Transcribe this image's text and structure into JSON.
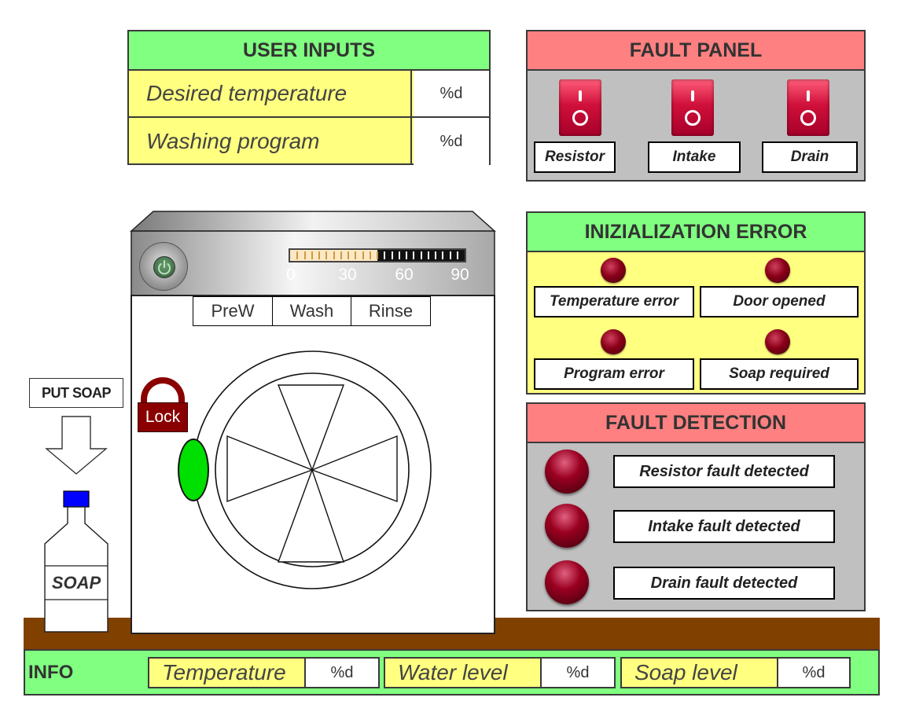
{
  "user_inputs": {
    "title": "USER INPUTS",
    "rows": [
      {
        "label": "Desired temperature",
        "value": "%d"
      },
      {
        "label": "Washing program",
        "value": "%d"
      }
    ]
  },
  "fault_panel": {
    "title": "FAULT PANEL",
    "switches": [
      {
        "label": "Resistor"
      },
      {
        "label": "Intake"
      },
      {
        "label": "Drain"
      }
    ]
  },
  "init_error": {
    "title": "INIZIALIZATION ERROR",
    "indicators": [
      {
        "label": "Temperature error"
      },
      {
        "label": "Door opened"
      },
      {
        "label": "Program error"
      },
      {
        "label": "Soap required"
      }
    ]
  },
  "fault_detection": {
    "title": "FAULT DETECTION",
    "indicators": [
      {
        "label": "Resistor fault detected"
      },
      {
        "label": "Intake fault detected"
      },
      {
        "label": "Drain fault detected"
      }
    ]
  },
  "machine": {
    "gauge_ticks": [
      "0",
      "30",
      "60",
      "90"
    ],
    "gauge_fill_fraction": 0.5,
    "programs": [
      "PreW",
      "Wash",
      "Rinse"
    ],
    "lock_label": "Lock",
    "door_handle_color": "#00e000"
  },
  "soap": {
    "button_label": "PUT SOAP",
    "bottle_label": "SOAP",
    "cap_color": "#0000ff"
  },
  "info": {
    "title": "INFO",
    "fields": [
      {
        "label": "Temperature",
        "value": "%d"
      },
      {
        "label": "Water level",
        "value": "%d"
      },
      {
        "label": "Soap level",
        "value": "%d"
      }
    ]
  },
  "colors": {
    "green": "#80ff80",
    "red": "#ff8080",
    "yellow": "#ffff80",
    "grey": "#c0c0c0",
    "floor": "#804000"
  }
}
